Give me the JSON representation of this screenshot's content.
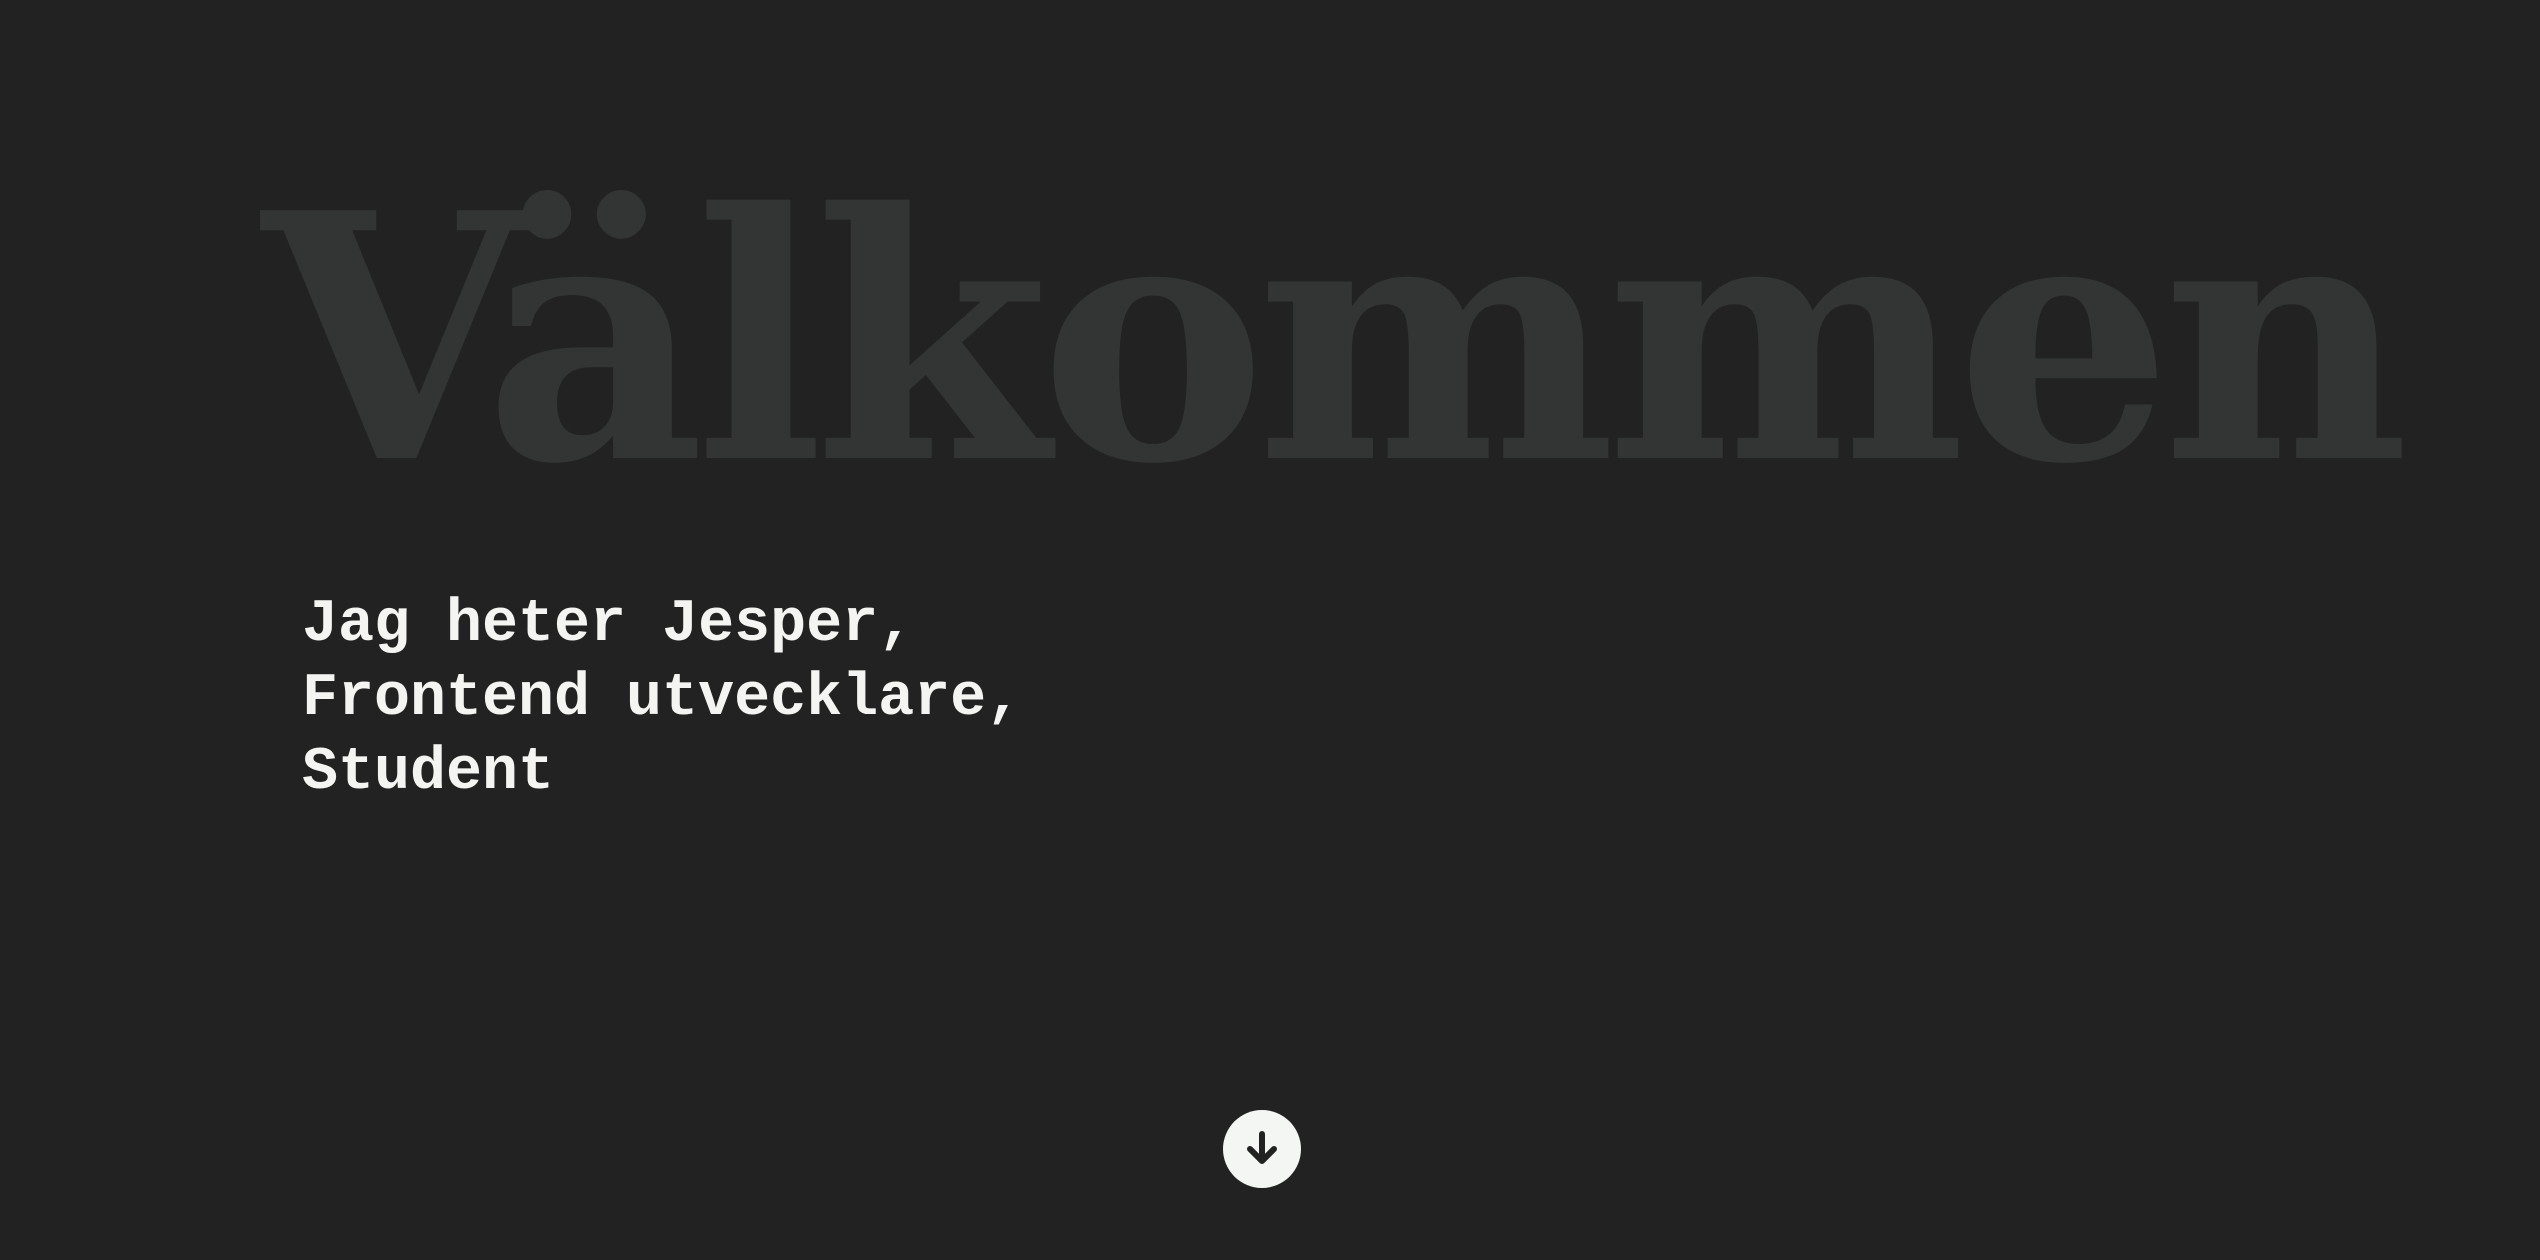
{
  "hero": {
    "title": "Välkommen",
    "intro_lines": [
      "Jag heter Jesper,",
      "Frontend utvecklare,",
      "Student"
    ],
    "scroll_icon": "arrow-down-circle-icon"
  },
  "colors": {
    "background": "#222222",
    "title": "#333535",
    "text": "#f4f4f2",
    "button": "#f4f6f4"
  }
}
